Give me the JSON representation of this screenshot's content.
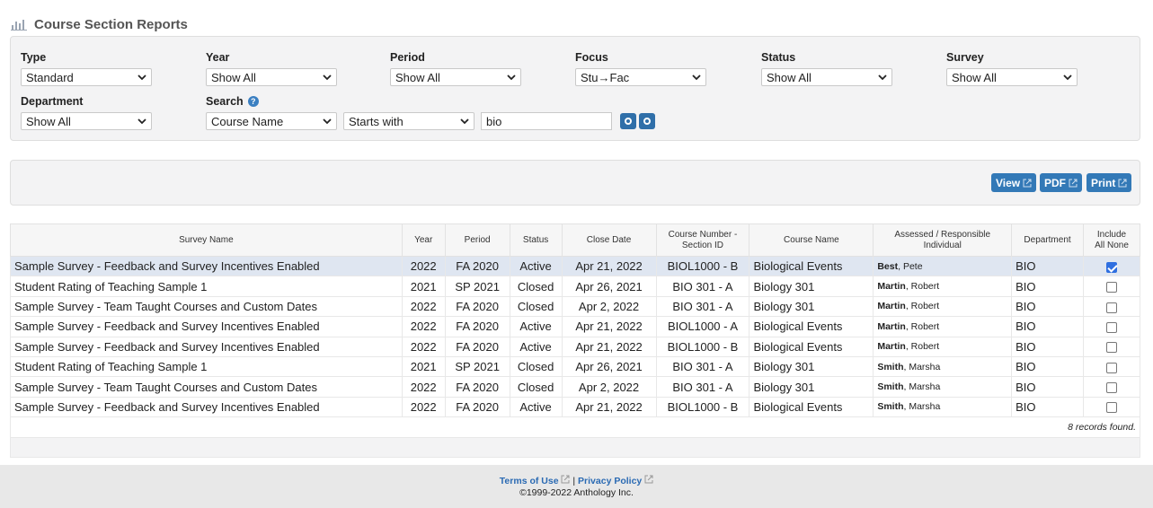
{
  "header": {
    "title": "Course Section Reports",
    "icon": "bar-chart-icon"
  },
  "filters": {
    "type": {
      "label": "Type",
      "value": "Standard"
    },
    "year": {
      "label": "Year",
      "value": "Show All"
    },
    "period": {
      "label": "Period",
      "value": "Show All"
    },
    "focus": {
      "label": "Focus",
      "value": "Stu→Fac"
    },
    "status": {
      "label": "Status",
      "value": "Show All"
    },
    "survey": {
      "label": "Survey",
      "value": "Show All"
    },
    "department": {
      "label": "Department",
      "value": "Show All"
    },
    "search": {
      "label": "Search",
      "field": "Course Name",
      "operator": "Starts with",
      "text": "bio"
    }
  },
  "actions": {
    "view": "View",
    "pdf": "PDF",
    "print": "Print"
  },
  "table": {
    "headers": {
      "survey_name": "Survey Name",
      "year": "Year",
      "period": "Period",
      "status": "Status",
      "close_date": "Close Date",
      "course_number": "Course Number - Section ID",
      "course_name": "Course Name",
      "individual": "Assessed / Responsible Individual",
      "department": "Department",
      "include": "Include",
      "all": "All",
      "none": "None"
    },
    "rows": [
      {
        "survey": "Sample Survey - Feedback and Survey Incentives Enabled",
        "year": "2022",
        "period": "FA 2020",
        "status": "Active",
        "close": "Apr 21, 2022",
        "course_num": "BIOL1000 - B",
        "course_name": "Biological Events",
        "last": "Best",
        "first": "Pete",
        "dept": "BIO",
        "checked": true
      },
      {
        "survey": "Student Rating of Teaching Sample 1",
        "year": "2021",
        "period": "SP 2021",
        "status": "Closed",
        "close": "Apr 26, 2021",
        "course_num": "BIO 301 - A",
        "course_name": "Biology 301",
        "last": "Martin",
        "first": "Robert",
        "dept": "BIO",
        "checked": false
      },
      {
        "survey": "Sample Survey - Team Taught Courses and Custom Dates",
        "year": "2022",
        "period": "FA 2020",
        "status": "Closed",
        "close": "Apr 2, 2022",
        "course_num": "BIO 301 - A",
        "course_name": "Biology 301",
        "last": "Martin",
        "first": "Robert",
        "dept": "BIO",
        "checked": false
      },
      {
        "survey": "Sample Survey - Feedback and Survey Incentives Enabled",
        "year": "2022",
        "period": "FA 2020",
        "status": "Active",
        "close": "Apr 21, 2022",
        "course_num": "BIOL1000 - A",
        "course_name": "Biological Events",
        "last": "Martin",
        "first": "Robert",
        "dept": "BIO",
        "checked": false
      },
      {
        "survey": "Sample Survey - Feedback and Survey Incentives Enabled",
        "year": "2022",
        "period": "FA 2020",
        "status": "Active",
        "close": "Apr 21, 2022",
        "course_num": "BIOL1000 - B",
        "course_name": "Biological Events",
        "last": "Martin",
        "first": "Robert",
        "dept": "BIO",
        "checked": false
      },
      {
        "survey": "Student Rating of Teaching Sample 1",
        "year": "2021",
        "period": "SP 2021",
        "status": "Closed",
        "close": "Apr 26, 2021",
        "course_num": "BIO 301 - A",
        "course_name": "Biology 301",
        "last": "Smith",
        "first": "Marsha",
        "dept": "BIO",
        "checked": false
      },
      {
        "survey": "Sample Survey - Team Taught Courses and Custom Dates",
        "year": "2022",
        "period": "FA 2020",
        "status": "Closed",
        "close": "Apr 2, 2022",
        "course_num": "BIO 301 - A",
        "course_name": "Biology 301",
        "last": "Smith",
        "first": "Marsha",
        "dept": "BIO",
        "checked": false
      },
      {
        "survey": "Sample Survey - Feedback and Survey Incentives Enabled",
        "year": "2022",
        "period": "FA 2020",
        "status": "Active",
        "close": "Apr 21, 2022",
        "course_num": "BIOL1000 - B",
        "course_name": "Biological Events",
        "last": "Smith",
        "first": "Marsha",
        "dept": "BIO",
        "checked": false
      }
    ],
    "records_found": "8 records found."
  },
  "footer": {
    "terms": "Terms of Use",
    "separator": "|",
    "privacy": "Privacy Policy",
    "copyright": "©1999-2022 Anthology Inc."
  },
  "colors": {
    "accent": "#3379b7",
    "selected_row": "#dfe6f1",
    "panel": "#f3f3f4"
  }
}
